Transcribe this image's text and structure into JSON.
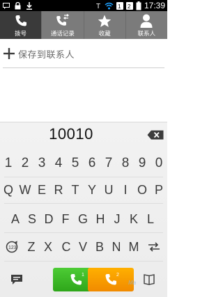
{
  "status_bar": {
    "time": "17:39",
    "left_icons": [
      "message-icon",
      "lock-icon",
      "download-icon"
    ],
    "right_icons": [
      "signal-t-icon",
      "wifi-icon",
      "sim1-signal-icon",
      "sim2-signal-icon",
      "battery-icon"
    ]
  },
  "tabs": [
    {
      "label": "拨号",
      "icon": "phone-icon",
      "active": true
    },
    {
      "label": "通话记录",
      "icon": "call-log-icon",
      "active": false
    },
    {
      "label": "收藏",
      "icon": "star-icon",
      "active": false
    },
    {
      "label": "联系人",
      "icon": "person-icon",
      "active": false
    }
  ],
  "save_contact": {
    "label": "保存到联系人"
  },
  "dialer": {
    "number": "10010"
  },
  "keyboard": {
    "row1": [
      "1",
      "2",
      "3",
      "4",
      "5",
      "6",
      "7",
      "8",
      "9",
      "0"
    ],
    "row2": [
      "Q",
      "W",
      "E",
      "R",
      "T",
      "Y",
      "U",
      "I",
      "O",
      "P"
    ],
    "row3": [
      "A",
      "S",
      "D",
      "F",
      "G",
      "H",
      "J",
      "K",
      "L"
    ],
    "row4": [
      "Z",
      "X",
      "C",
      "V",
      "B",
      "N",
      "M"
    ]
  },
  "call_buttons": {
    "sim1_label": "1",
    "sim2_label": "2"
  },
  "watermark": {
    "text": "Ma"
  },
  "colors": {
    "status_bar": "#000000",
    "tab_bar": "#7b7b7b",
    "tab_active": "#3a3a3a",
    "call_sim1": "#3cb827",
    "call_sim2": "#f59a00"
  }
}
